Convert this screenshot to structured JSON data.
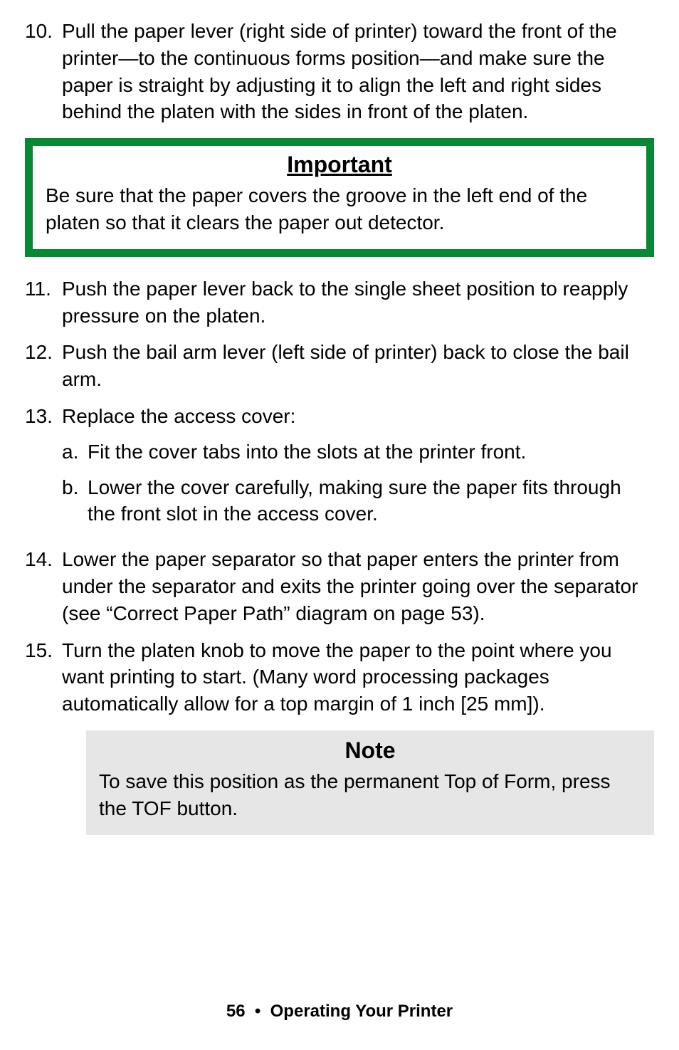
{
  "item10": {
    "num": "10.",
    "text": "Pull the paper lever (right side of printer) toward the front of the printer—to the continuous forms position—and make sure the paper is straight by adjusting it to align the left and right sides behind the platen with the sides in front of the platen."
  },
  "important": {
    "title": "Important",
    "body": "Be sure that the paper covers the groove in the left end of the platen so that it clears the paper out detector."
  },
  "item11": {
    "num": "11.",
    "text": "Push the paper lever back to the single sheet position to reapply pressure on the platen."
  },
  "item12": {
    "num": "12.",
    "text": "Push the bail arm lever (left side of printer) back to close the bail arm."
  },
  "item13": {
    "num": "13.",
    "text": "Replace the access cover:",
    "a": {
      "num": "a.",
      "text": "Fit the cover tabs into the slots at the printer front."
    },
    "b": {
      "num": "b.",
      "text": "Lower the cover carefully, making sure the paper fits through the front slot in the access cover."
    }
  },
  "item14": {
    "num": "14.",
    "text": "Lower the paper separator so that paper enters the printer from under the separator and exits the printer going over the separator (see “Correct Paper Path” diagram on page 53)."
  },
  "item15": {
    "num": "15.",
    "text": "Turn the platen knob to move the paper to the point where you want printing to start. (Many word processing packages automatically allow for a top margin of 1 inch [25 mm])."
  },
  "note": {
    "title": "Note",
    "body": "To save this position as the permanent Top of Form, press the TOF button."
  },
  "footer": {
    "page": "56",
    "dot": "•",
    "section": "Operating Your Printer"
  }
}
